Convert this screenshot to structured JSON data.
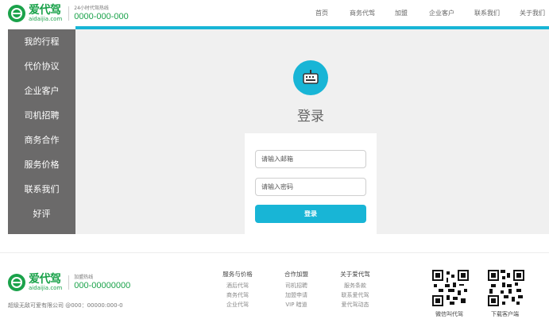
{
  "header": {
    "logo_name": "爱代驾",
    "logo_domain": "aidaijia.com",
    "hotline_label": "24小时代驾热线",
    "hotline_number": "0000-000-000",
    "nav": [
      "首页",
      "商务代驾",
      "加盟",
      "企业客户",
      "联系我们",
      "关于我们"
    ]
  },
  "sidebar": {
    "items": [
      "我的行程",
      "代价协议",
      "企业客户",
      "司机招聘",
      "商务合作",
      "服务价格",
      "联系我们",
      "好评"
    ]
  },
  "login": {
    "title": "登录",
    "email_placeholder": "请输入邮箱",
    "password_placeholder": "请输入密码",
    "button_label": "登录"
  },
  "footer": {
    "logo_name": "爱代驾",
    "logo_domain": "aidaijia.com",
    "hotline_label": "加盟热线",
    "hotline_number": "000-00000000",
    "copyright": "超级无敌可爱有限公司 @000：00000:000-0",
    "columns": [
      {
        "title": "服务与价格",
        "links": [
          "酒后代驾",
          "商务代驾",
          "企业代驾"
        ]
      },
      {
        "title": "合作加盟",
        "links": [
          "司机招聘",
          "加盟申请",
          "VIP 暗道"
        ]
      },
      {
        "title": "关于爱代驾",
        "links": [
          "服务条款",
          "联系爱代驾",
          "爱代驾动态"
        ]
      }
    ],
    "qr": [
      {
        "label": "微信叫代驾"
      },
      {
        "label": "下载客户端"
      }
    ]
  },
  "colors": {
    "brand_green": "#1aa24a",
    "accent_blue": "#18b5d6",
    "sidebar_gray": "#6b6a6a"
  }
}
